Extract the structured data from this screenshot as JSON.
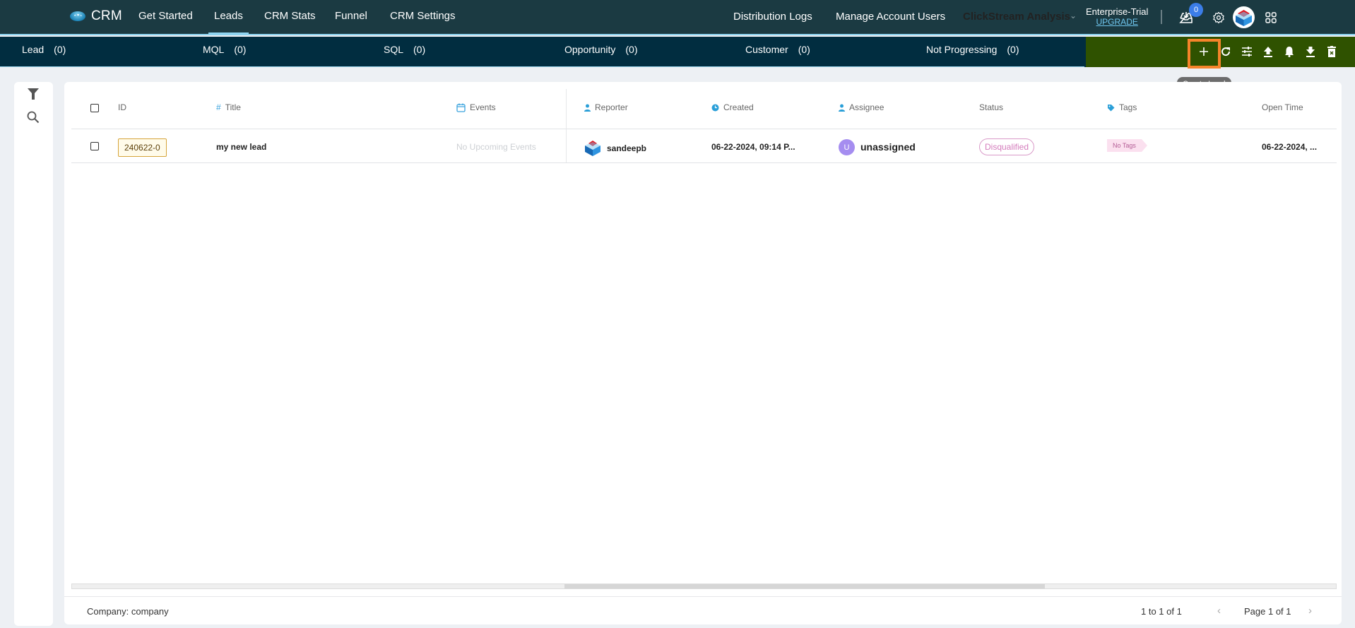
{
  "app": {
    "name": "CRM",
    "nav": [
      {
        "label": "Get Started",
        "active": false
      },
      {
        "label": "Leads",
        "active": true
      },
      {
        "label": "CRM Stats",
        "active": false
      },
      {
        "label": "Funnel",
        "active": false
      },
      {
        "label": "CRM Settings",
        "active": false
      }
    ],
    "right_nav": {
      "distribution_logs": "Distribution Logs",
      "manage_users": "Manage Account Users",
      "project": "ClickStream Analysis",
      "plan_name": "Enterprise-Trial",
      "upgrade": "UPGRADE",
      "inbox_count": "0"
    },
    "icons": [
      "crm-logo-icon",
      "inbox-download-icon",
      "gear-icon",
      "user-avatar",
      "apps-grid-icon"
    ]
  },
  "stages": [
    {
      "label": "Lead",
      "count": "(0)"
    },
    {
      "label": "MQL",
      "count": "(0)"
    },
    {
      "label": "SQL",
      "count": "(0)"
    },
    {
      "label": "Opportunity",
      "count": "(0)"
    },
    {
      "label": "Customer",
      "count": "(0)"
    },
    {
      "label": "Not Progressing",
      "count": "(0)"
    }
  ],
  "actions": {
    "items": [
      "plus-icon",
      "refresh-icon",
      "sliders-icon",
      "upload-icon",
      "bell-icon",
      "download-icon",
      "delete-icon"
    ],
    "tooltip": "Create Lead",
    "highlight_color": "#f5842a",
    "bar_color": "#2f5200"
  },
  "table": {
    "columns": {
      "id": "ID",
      "title": "Title",
      "events": "Events",
      "reporter": "Reporter",
      "created": "Created",
      "assignee": "Assignee",
      "status": "Status",
      "tags": "Tags",
      "open_time": "Open Time"
    },
    "rows": [
      {
        "id": "240622-0",
        "title": "my new lead",
        "events": "No Upcoming Events",
        "reporter": "sandeepb",
        "created": "06-22-2024, 09:14 P...",
        "assignee_initial": "U",
        "assignee": "unassigned",
        "status": "Disqualified",
        "tags": "No Tags",
        "open_time": "06-22-2024, ..."
      }
    ]
  },
  "footer": {
    "company": "Company: company",
    "range": "1 to 1 of 1",
    "page": "Page 1 of 1",
    "prev": "‹",
    "next": "›"
  }
}
